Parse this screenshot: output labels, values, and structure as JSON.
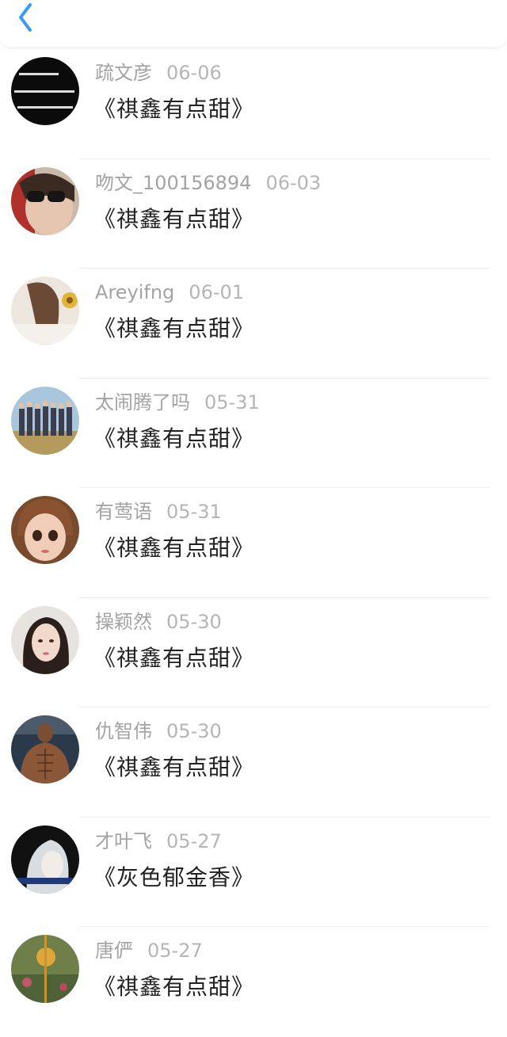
{
  "colors": {
    "accent": "#3a9bf0",
    "username": "#a3a3a3",
    "date": "#b5b5b5",
    "comment": "#222222",
    "divider": "#efefef"
  },
  "nav": {
    "back_icon": "chevron-left-icon"
  },
  "entries": [
    {
      "username": "疏文彦",
      "date": "06-06",
      "comment": "《祺鑫有点甜》"
    },
    {
      "username": "吻文_100156894",
      "date": "06-03",
      "comment": "《祺鑫有点甜》"
    },
    {
      "username": "Areyifng",
      "date": "06-01",
      "comment": "《祺鑫有点甜》"
    },
    {
      "username": "太闹腾了吗",
      "date": "05-31",
      "comment": "《祺鑫有点甜》"
    },
    {
      "username": "有莺语",
      "date": "05-31",
      "comment": "《祺鑫有点甜》"
    },
    {
      "username": "操颖然",
      "date": "05-30",
      "comment": "《祺鑫有点甜》"
    },
    {
      "username": "仇智伟",
      "date": "05-30",
      "comment": "《祺鑫有点甜》"
    },
    {
      "username": "才叶飞",
      "date": "05-27",
      "comment": "《灰色郁金香》"
    },
    {
      "username": "唐俨",
      "date": "05-27",
      "comment": "《祺鑫有点甜》"
    }
  ]
}
